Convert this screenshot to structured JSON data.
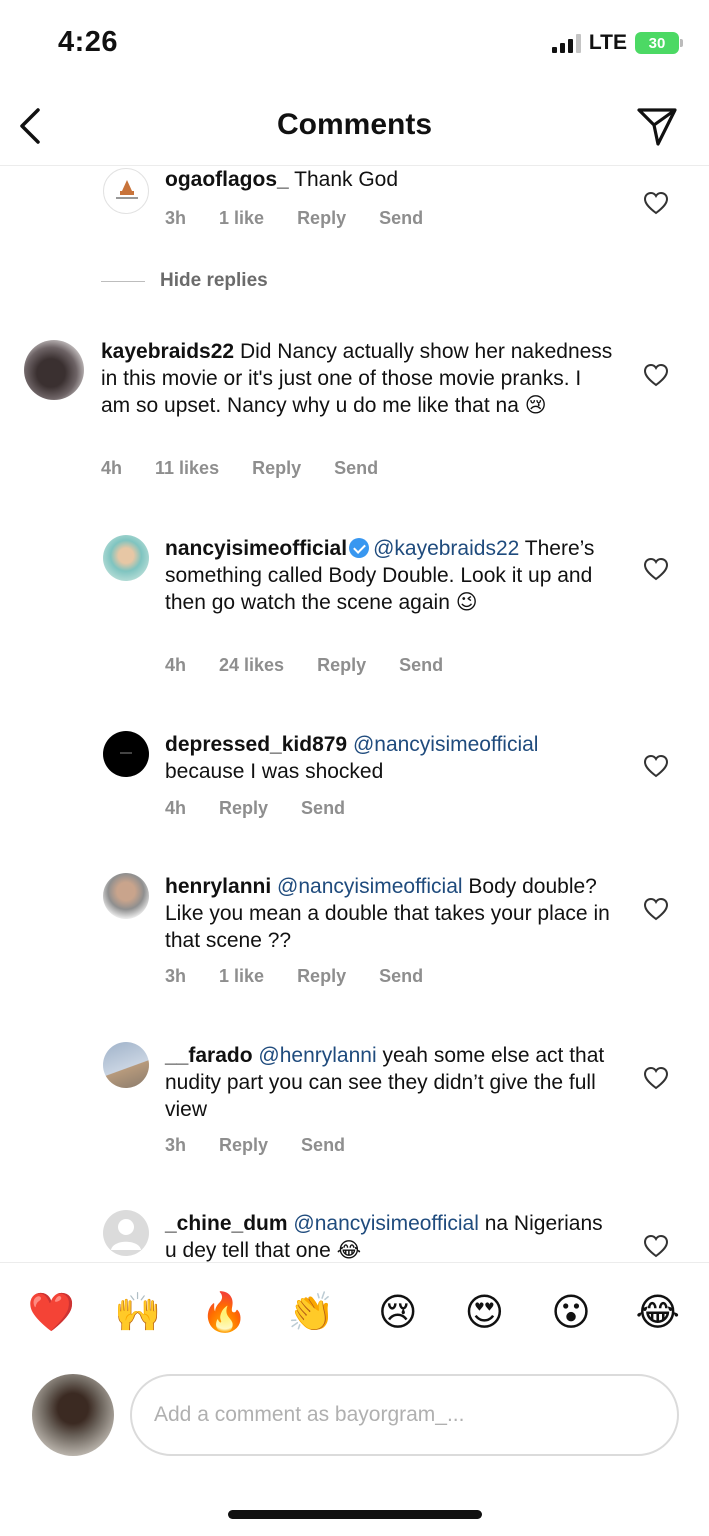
{
  "status": {
    "time": "4:26",
    "network": "LTE",
    "battery": "30"
  },
  "header": {
    "title": "Comments"
  },
  "hide_replies": "Hide replies",
  "comments": [
    {
      "username": "ogaoflagos_",
      "text": " Thank God",
      "time": "3h",
      "likes": "1 like",
      "reply": "Reply",
      "send": "Send"
    },
    {
      "username": "kayebraids22",
      "text": " Did Nancy actually show her nakedness in this movie or it's just one of those movie pranks. I am so upset. Nancy why u do me like that na 😢",
      "time": "4h",
      "likes": "11 likes",
      "reply": "Reply",
      "send": "Send"
    },
    {
      "username": "nancyisimeofficial",
      "mention": "@kayebraids22",
      "text": " There’s something called Body Double. Look it up and then go watch the scene again 😉",
      "time": "4h",
      "likes": "24 likes",
      "reply": "Reply",
      "send": "Send"
    },
    {
      "username": "depressed_kid879",
      "mention": "@nancyisimeofficial",
      "text": " because I was shocked",
      "time": "4h",
      "reply": "Reply",
      "send": "Send"
    },
    {
      "username": "henrylanni",
      "mention": "@nancyisimeofficial",
      "text": " Body double? Like you mean a double that takes your place in that scene ??",
      "time": "3h",
      "likes": "1 like",
      "reply": "Reply",
      "send": "Send"
    },
    {
      "username": "__farado",
      "mention": "@henrylanni",
      "text": " yeah some else act that nudity part you can see they didn’t give the full view",
      "time": "3h",
      "reply": "Reply",
      "send": "Send"
    },
    {
      "username": "_chine_dum",
      "mention": "@nancyisimeofficial",
      "text": " na Nigerians u dey tell that one 😂"
    }
  ],
  "emojis": [
    "❤️",
    "🙌",
    "🔥",
    "👏",
    "😢",
    "😍",
    "😮",
    "😂"
  ],
  "composer": {
    "placeholder": "Add a comment as bayorgram_..."
  }
}
